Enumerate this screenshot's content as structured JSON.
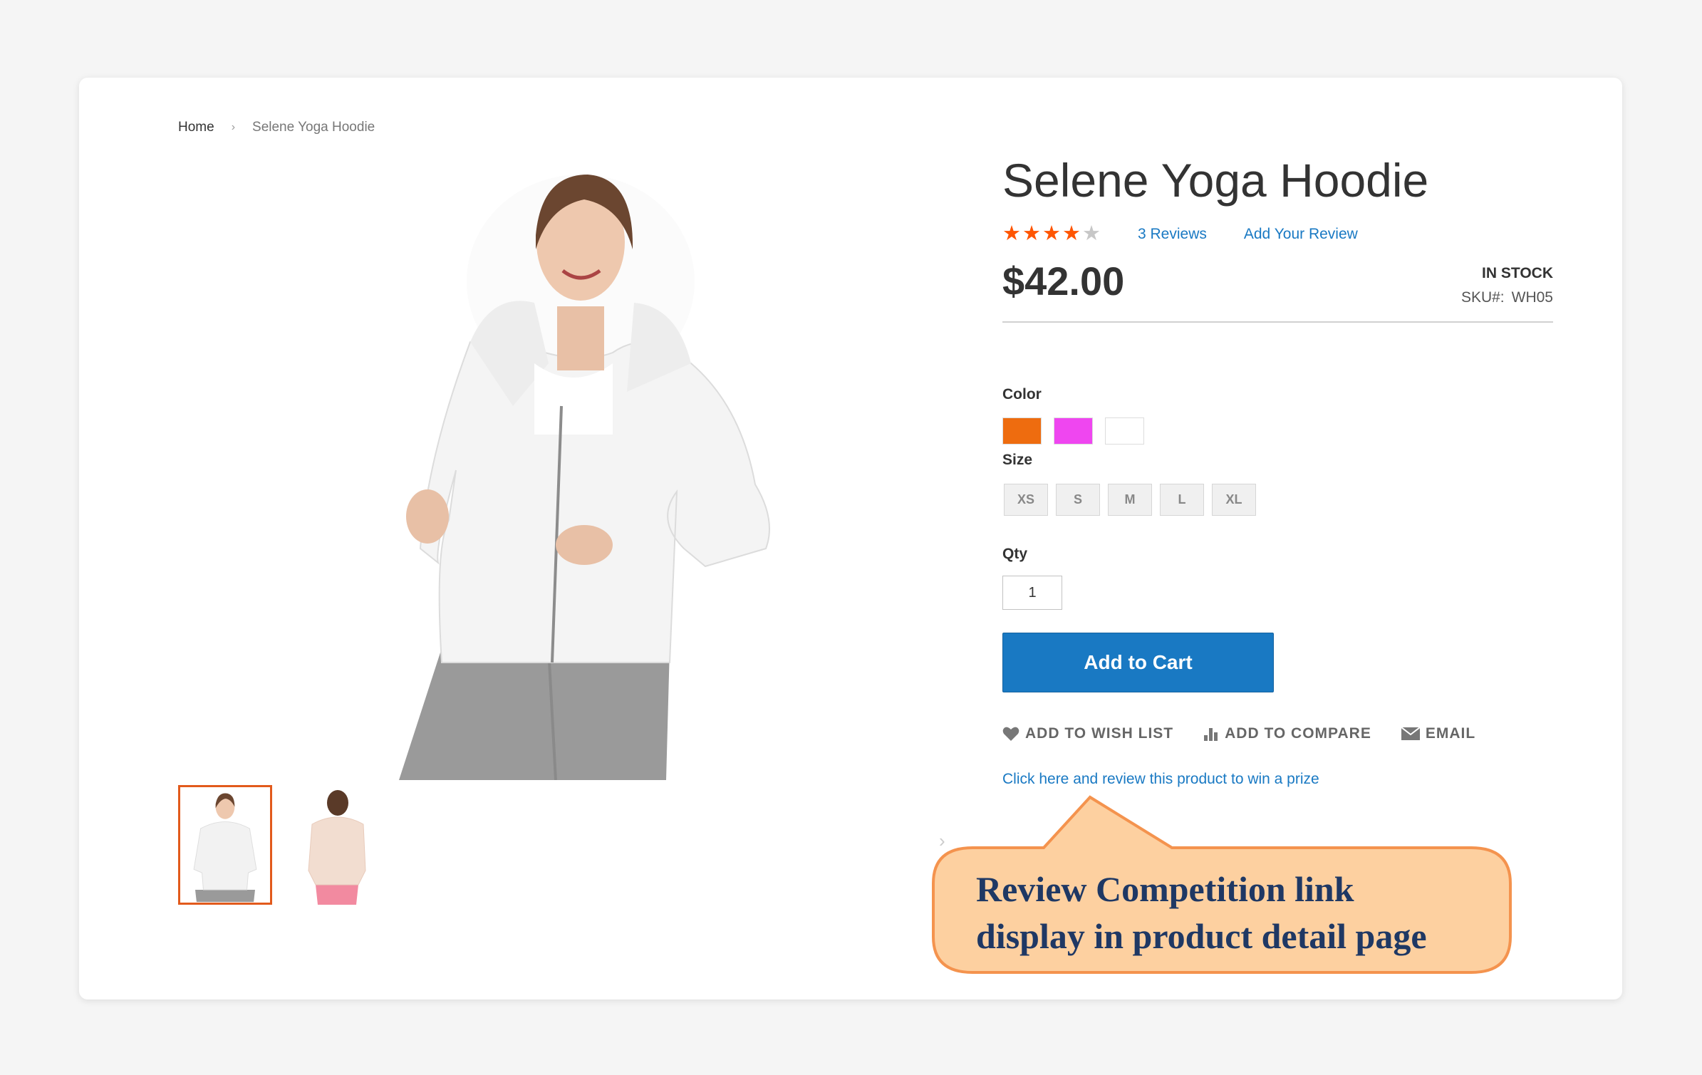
{
  "breadcrumb": {
    "home": "Home",
    "separator": "›",
    "current": "Selene Yoga Hoodie"
  },
  "product": {
    "title": "Selene Yoga Hoodie",
    "rating": {
      "stars_filled": 4,
      "stars_total": 5,
      "reviews_label": "3 Reviews",
      "add_review_label": "Add Your Review"
    },
    "price": "$42.00",
    "stock_status": "IN STOCK",
    "sku_label": "SKU#:",
    "sku_value": "WH05"
  },
  "options": {
    "color_label": "Color",
    "colors": [
      "#ee6c0f",
      "#ef46f0",
      "#ffffff"
    ],
    "size_label": "Size",
    "sizes": [
      "XS",
      "S",
      "M",
      "L",
      "XL"
    ],
    "qty_label": "Qty",
    "qty_value": "1"
  },
  "buttons": {
    "add_to_cart": "Add to Cart"
  },
  "actions": {
    "wish_list": "ADD TO WISH LIST",
    "compare": "ADD TO COMPARE",
    "email": "EMAIL"
  },
  "review_competition_link": "Click here and review this product to win a prize",
  "callout": {
    "line1": "Review Competition link",
    "line2": "display in product detail page"
  },
  "colors": {
    "link": "#1979c3",
    "star": "#ff5501",
    "thumb_active_border": "#e25a1c",
    "callout_fill": "#fdd0a0",
    "callout_border": "#f4934e",
    "callout_text": "#1f3864"
  }
}
